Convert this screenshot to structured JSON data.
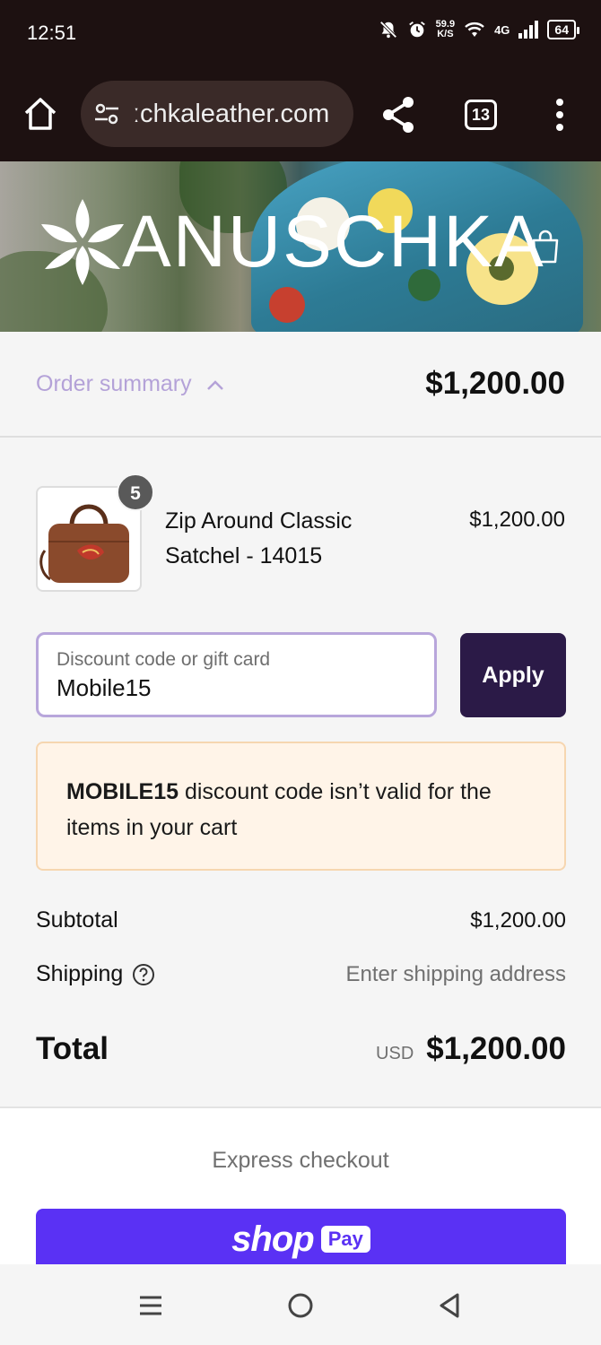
{
  "status_bar": {
    "time": "12:51",
    "net_speed_value": "59.9",
    "net_speed_unit": "K/S",
    "network": "4G",
    "battery": "64"
  },
  "browser": {
    "url": "ːchkaleather.com",
    "tab_count": "13"
  },
  "hero": {
    "brand": "ANUSCHKA"
  },
  "order_summary": {
    "toggle_label": "Order summary",
    "total": "$1,200.00"
  },
  "line_item": {
    "quantity": "5",
    "name": "Zip Around Classic Satchel - 14015",
    "price": "$1,200.00"
  },
  "discount": {
    "placeholder": "Discount code or gift card",
    "value": "Mobile15",
    "apply_label": "Apply"
  },
  "notice": {
    "code": "MOBILE15",
    "message": " discount code isn’t valid for the items in your cart"
  },
  "totals": {
    "subtotal_label": "Subtotal",
    "subtotal_value": "$1,200.00",
    "shipping_label": "Shipping",
    "shipping_value": "Enter shipping address",
    "total_label": "Total",
    "currency": "USD",
    "total_value": "$1,200.00"
  },
  "express": {
    "title": "Express checkout",
    "shop_label": "shop",
    "pay_label": "Pay"
  },
  "colors": {
    "accent": "#2b1a47",
    "shop_pay": "#5a31f4",
    "link": "#b4a2d8",
    "notice_bg": "#fff4e8"
  }
}
